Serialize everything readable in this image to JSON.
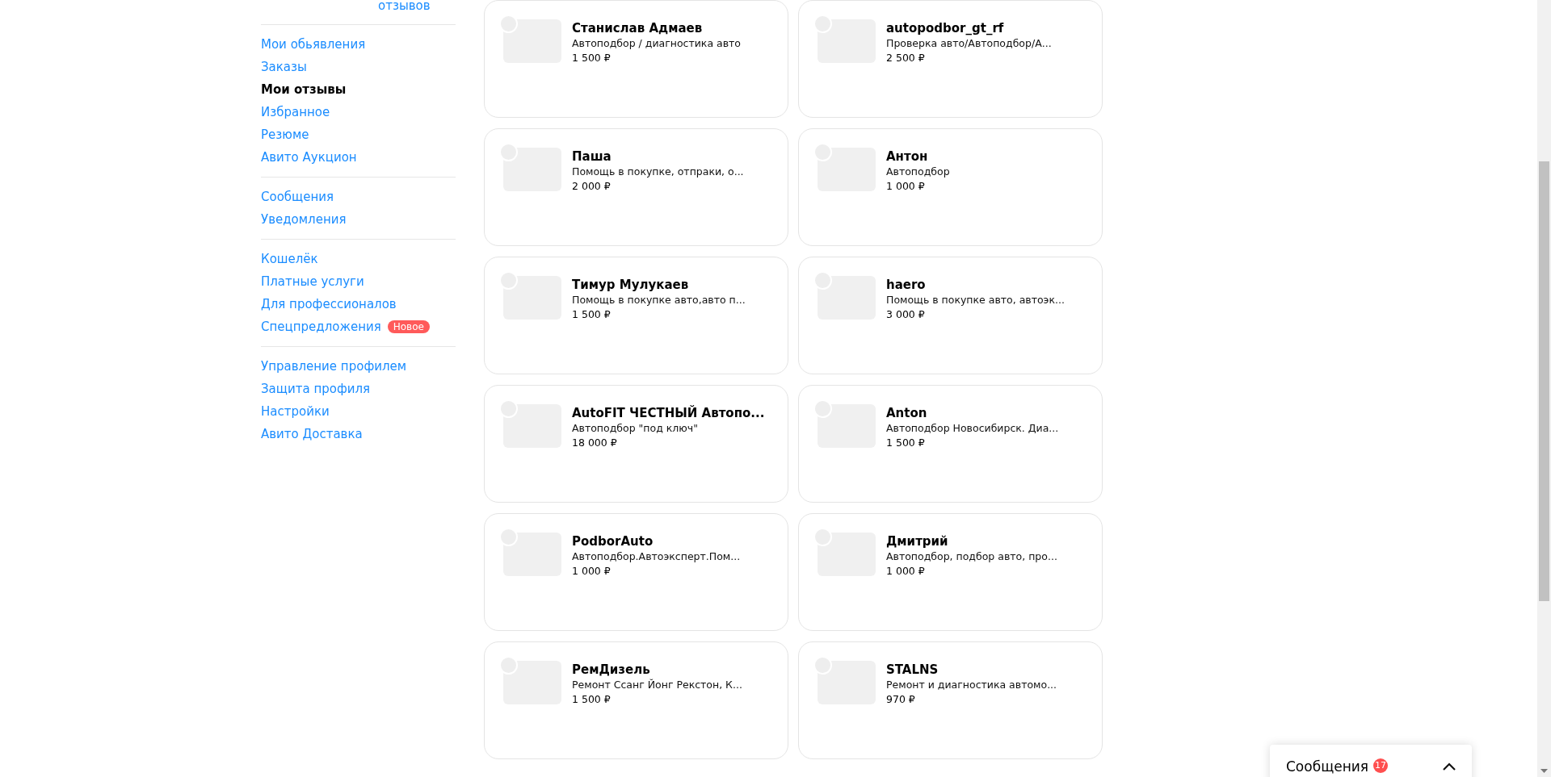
{
  "sidebar": {
    "top_link": "отзывов",
    "groups": [
      [
        {
          "label": "Мои обьявления",
          "selected": false
        },
        {
          "label": "Заказы",
          "selected": false
        },
        {
          "label": "Мои отзывы",
          "selected": true
        },
        {
          "label": "Избранное",
          "selected": false
        },
        {
          "label": "Резюме",
          "selected": false
        },
        {
          "label": "Авито Аукцион",
          "selected": false
        }
      ],
      [
        {
          "label": "Сообщения",
          "selected": false
        },
        {
          "label": "Уведомления",
          "selected": false
        }
      ],
      [
        {
          "label": "Кошелёк",
          "selected": false
        },
        {
          "label": "Платные услуги",
          "selected": false
        },
        {
          "label": "Для профессионалов",
          "selected": false
        },
        {
          "label": "Спецпредложения",
          "selected": false,
          "badge": "Новое"
        }
      ],
      [
        {
          "label": "Управление профилем",
          "selected": false
        },
        {
          "label": "Защита профиля",
          "selected": false
        },
        {
          "label": "Настройки",
          "selected": false
        },
        {
          "label": "Авито Доставка",
          "selected": false
        }
      ]
    ]
  },
  "cards": [
    {
      "name": "Станислав Адмаев",
      "description": "Автоподбор / диагностика авто",
      "price": "1 500 ₽"
    },
    {
      "name": "autopodbor_gt_rf",
      "description": "Проверка авто/Автоподбор/А...",
      "price": "2 500 ₽"
    },
    {
      "name": "Паша",
      "description": "Помощь в покупке, отпраки, о...",
      "price": "2 000 ₽"
    },
    {
      "name": "Антон",
      "description": "Автоподбор",
      "price": "1 000 ₽"
    },
    {
      "name": "Тимур Мулукаев",
      "description": "Помощь в покупке авто,авто п...",
      "price": "1 500 ₽"
    },
    {
      "name": "haero",
      "description": "Помощь в покупке авто, автоэк...",
      "price": "3 000 ₽"
    },
    {
      "name": "AutoFIT ЧЕСТНЫЙ Автопо...",
      "description": "Автоподбор \"под ключ\"",
      "price": "18 000 ₽"
    },
    {
      "name": "Anton",
      "description": "Автоподбор Новосибирск. Диа...",
      "price": "1 500 ₽"
    },
    {
      "name": "PodborAuto",
      "description": "Автоподбор.Автоэксперт.Пом...",
      "price": "1 000 ₽"
    },
    {
      "name": "Дмитрий",
      "description": "Автоподбор, подбор авто, про...",
      "price": "1 000 ₽"
    },
    {
      "name": "РемДизель",
      "description": "Ремонт Ссанг Йонг Рекстон, К...",
      "price": "1 500 ₽"
    },
    {
      "name": "STALNS",
      "description": "Ремонт и диагностика автомо...",
      "price": "970 ₽"
    }
  ],
  "messages_widget": {
    "title": "Сообщения",
    "count": "17",
    "expanded": false
  }
}
